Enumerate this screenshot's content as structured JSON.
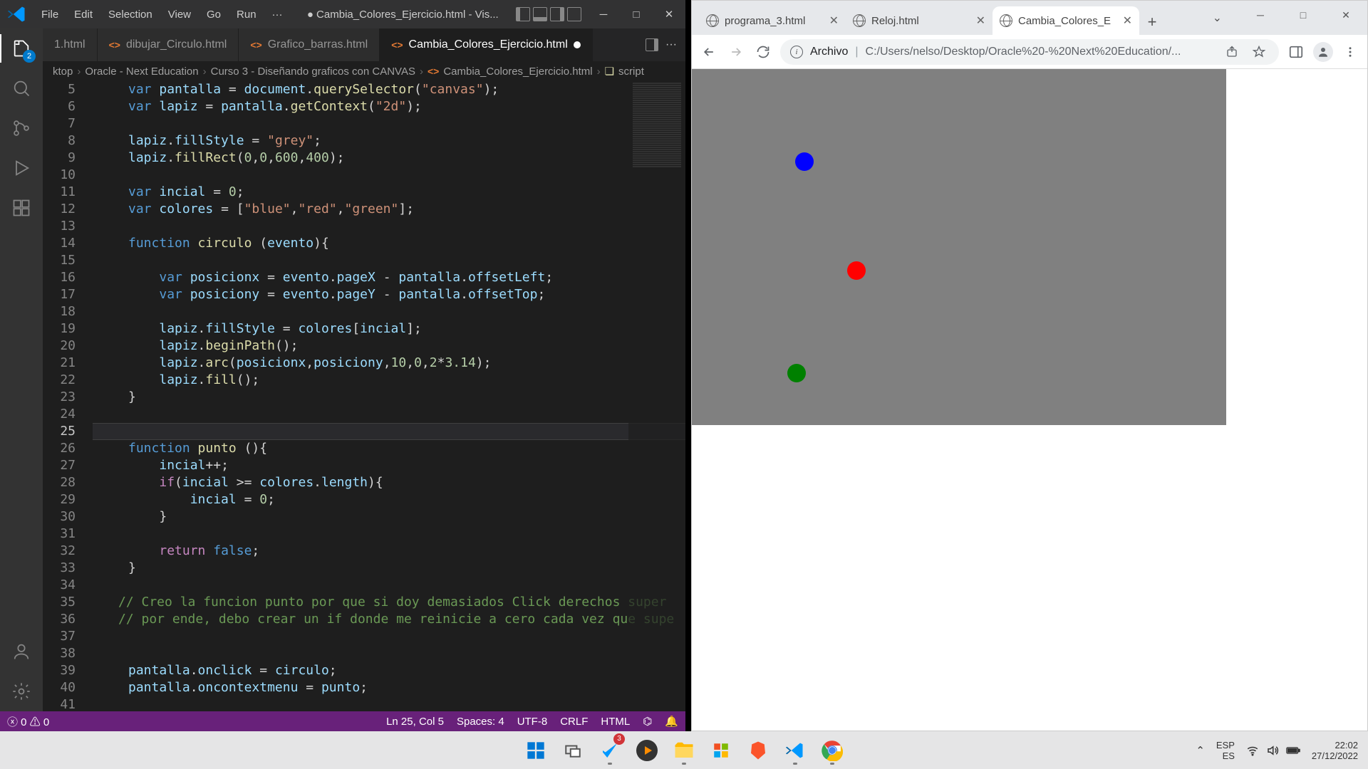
{
  "vscode": {
    "menu": [
      "File",
      "Edit",
      "Selection",
      "View",
      "Go",
      "Run",
      "···"
    ],
    "titlebar": "● Cambia_Colores_Ejercicio.html - Vis...",
    "explorer_badge": "2",
    "tabs": [
      {
        "label": "1.html",
        "active": false,
        "dirty": false
      },
      {
        "label": "dibujar_Circulo.html",
        "active": false,
        "dirty": false
      },
      {
        "label": "Grafico_barras.html",
        "active": false,
        "dirty": false
      },
      {
        "label": "Cambia_Colores_Ejercicio.html",
        "active": true,
        "dirty": true
      }
    ],
    "breadcrumb": [
      "ktop",
      "Oracle - Next Education",
      "Curso 3 - Diseñando graficos con CANVAS",
      "Cambia_Colores_Ejercicio.html",
      "script"
    ],
    "line_start": 5,
    "line_end": 41,
    "current_line": 25,
    "statusbar": {
      "errors": "0",
      "warnings": "0",
      "cursor": "Ln 25, Col 5",
      "spaces": "Spaces: 4",
      "encoding": "UTF-8",
      "eol": "CRLF",
      "language": "HTML"
    }
  },
  "chrome": {
    "tabs": [
      {
        "label": "programa_3.html",
        "active": false
      },
      {
        "label": "Reloj.html",
        "active": false
      },
      {
        "label": "Cambia_Colores_E",
        "active": true
      }
    ],
    "url_scheme": "Archivo",
    "url_path": "C:/Users/nelso/Desktop/Oracle%20-%20Next%20Education/..."
  },
  "system": {
    "lang1": "ESP",
    "lang2": "ES",
    "time": "22:02",
    "date": "27/12/2022",
    "codeiumbadge": "3"
  }
}
